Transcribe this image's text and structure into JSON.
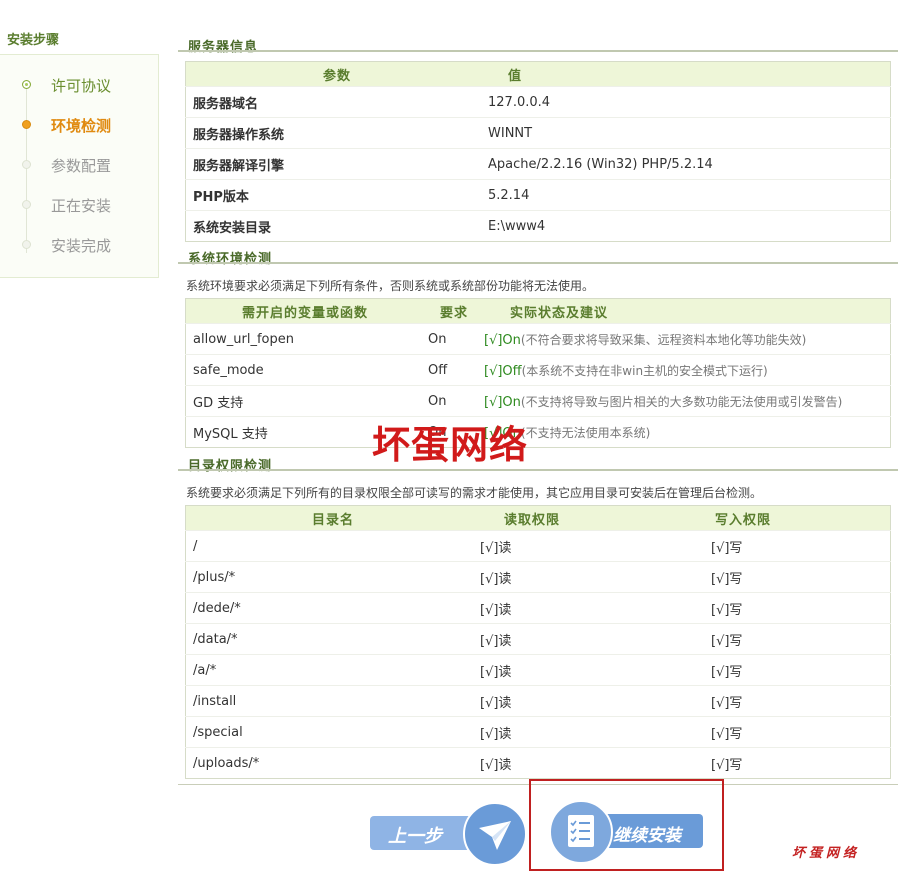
{
  "sidebar": {
    "title": "安装步骤",
    "steps": [
      {
        "label": "许可协议",
        "state": "done"
      },
      {
        "label": "环境检测",
        "state": "current"
      },
      {
        "label": "参数配置",
        "state": "todo"
      },
      {
        "label": "正在安装",
        "state": "todo"
      },
      {
        "label": "安装完成",
        "state": "todo"
      }
    ]
  },
  "server": {
    "title": "服务器信息",
    "col_param": "参数",
    "col_value": "值",
    "rows": [
      {
        "name": "服务器域名",
        "value": "127.0.0.4"
      },
      {
        "name": "服务器操作系统",
        "value": "WINNT"
      },
      {
        "name": "服务器解译引擎",
        "value": "Apache/2.2.16 (Win32) PHP/5.2.14"
      },
      {
        "name": "PHP版本",
        "value": "5.2.14"
      },
      {
        "name": "系统安装目录",
        "value": "E:\\www4"
      }
    ]
  },
  "env": {
    "title": "系统环境检测",
    "note": "系统环境要求必须满足下列所有条件，否则系统或系统部份功能将无法使用。",
    "col_var": "需开启的变量或函数",
    "col_req": "要求",
    "col_status": "实际状态及建议",
    "rows": [
      {
        "name": "allow_url_fopen",
        "req": "On",
        "status": "[√]On",
        "note": "(不符合要求将导致采集、远程资料本地化等功能失效)"
      },
      {
        "name": "safe_mode",
        "req": "Off",
        "status": "[√]Off",
        "note": "(本系统不支持在非win主机的安全模式下运行)"
      },
      {
        "name": "GD 支持",
        "req": "On",
        "status": "[√]On",
        "note": "(不支持将导致与图片相关的大多数功能无法使用或引发警告)"
      },
      {
        "name": "MySQL 支持",
        "req": "On",
        "status": "[√]On",
        "note": "(不支持无法使用本系统)"
      }
    ]
  },
  "dirs": {
    "title": "目录权限检测",
    "note": "系统要求必须满足下列所有的目录权限全部可读写的需求才能使用，其它应用目录可安装后在管理后台检测。",
    "col_dir": "目录名",
    "col_read": "读取权限",
    "col_write": "写入权限",
    "rows": [
      {
        "dir": "/",
        "read": "[√]读",
        "write": "[√]写"
      },
      {
        "dir": "/plus/*",
        "read": "[√]读",
        "write": "[√]写"
      },
      {
        "dir": "/dede/*",
        "read": "[√]读",
        "write": "[√]写"
      },
      {
        "dir": "/data/*",
        "read": "[√]读",
        "write": "[√]写"
      },
      {
        "dir": "/a/*",
        "read": "[√]读",
        "write": "[√]写"
      },
      {
        "dir": "/install",
        "read": "[√]读",
        "write": "[√]写"
      },
      {
        "dir": "/special",
        "read": "[√]读",
        "write": "[√]写"
      },
      {
        "dir": "/uploads/*",
        "read": "[√]读",
        "write": "[√]写"
      }
    ]
  },
  "buttons": {
    "prev": "上一步",
    "next": "继续安装"
  },
  "watermark": "坏蛋网络",
  "signature": "坏蛋网络",
  "colors": {
    "accent_green": "#5a7d2e",
    "ok_green": "#2e8a1f",
    "current_orange": "#e08a10",
    "button_blue": "#6a9bd8",
    "highlight_red": "#c02020"
  }
}
